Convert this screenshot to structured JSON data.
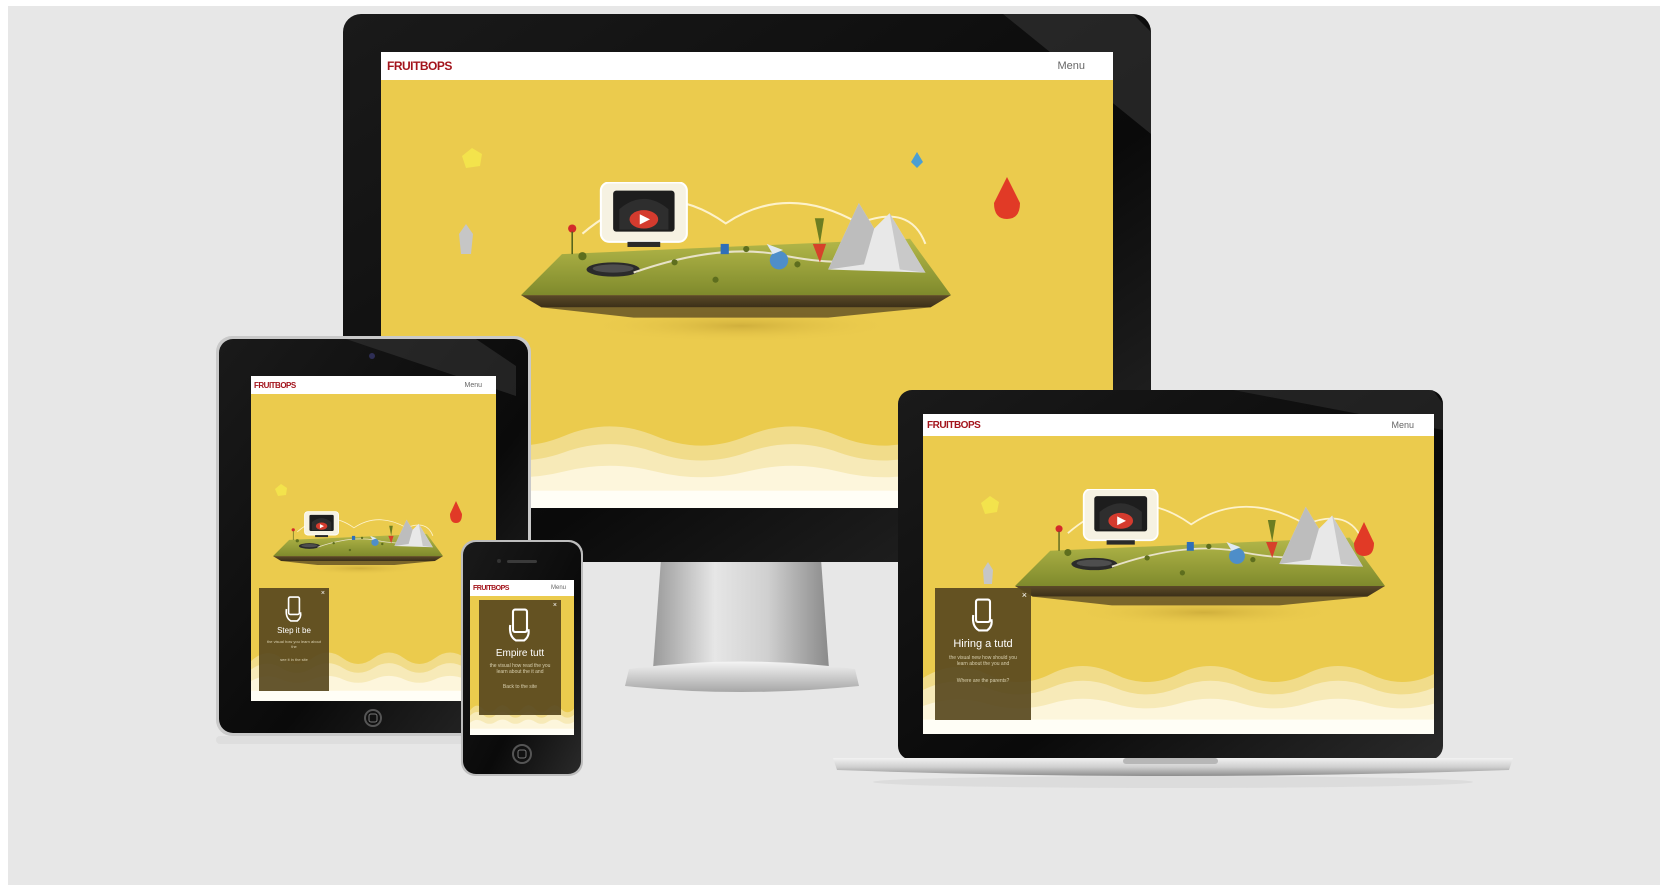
{
  "site": {
    "logo_text": "FRUITBOPS",
    "menu_label": "Menu"
  },
  "popup_desktop": {
    "title": "Hiring a tutd",
    "body": "the visual new how should you learn about the you and",
    "footer": "Where are the parents?"
  },
  "popup_phone": {
    "title": "Empire tutt",
    "body": "the visual how read the you learn about the it and",
    "footer": "Back to the site"
  },
  "popup_tablet": {
    "title": "Step it be",
    "body": "the visual how you learn about the",
    "footer": "see it in the site"
  },
  "colors": {
    "background": "#e7e7e7",
    "screen_yellow": "#ebcb4d",
    "island_grass": "#9ca43a",
    "logo_red": "#a3141c",
    "popup_brown": "#58481e"
  },
  "icons": [
    "phone-hand-icon",
    "play-icon",
    "close-icon",
    "drop-icon",
    "gem-icon"
  ]
}
